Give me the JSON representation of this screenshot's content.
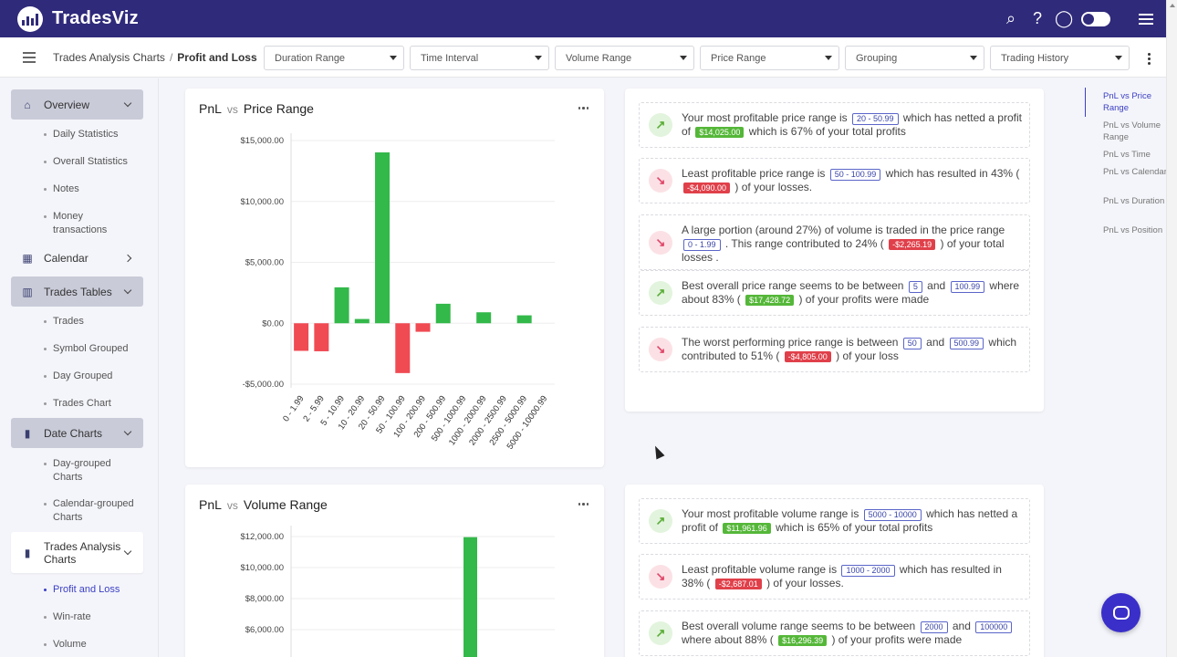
{
  "app": {
    "name": "TradesViz"
  },
  "topbar": {
    "icons": [
      "search-icon",
      "help-icon",
      "chat-icon",
      "theme-toggle",
      "menu-icon"
    ]
  },
  "breadcrumb": {
    "parent": "Trades Analysis Charts",
    "separator": "/",
    "current": "Profit and Loss"
  },
  "filters": [
    "Duration Range",
    "Time Interval",
    "Volume Range",
    "Price Range",
    "Grouping",
    "Trading History"
  ],
  "sidebar": {
    "overview": "Overview",
    "overview_items": [
      "Daily Statistics",
      "Overall Statistics",
      "Notes",
      "Money transactions"
    ],
    "calendar": "Calendar",
    "trades_tables": "Trades Tables",
    "trades_items": [
      "Trades",
      "Symbol Grouped",
      "Day Grouped",
      "Trades Chart"
    ],
    "date_charts": "Date Charts",
    "date_items": [
      "Day-grouped Charts",
      "Calendar-grouped Charts"
    ],
    "analysis": "Trades Analysis Charts",
    "analysis_items": [
      "Profit and Loss",
      "Win-rate",
      "Volume"
    ]
  },
  "chart1": {
    "title_a": "PnL",
    "vs": "vs",
    "title_b": "Price Range",
    "chart_data": {
      "type": "bar",
      "categories": [
        "0 - 1.99",
        "2 - 5.99",
        "5 - 10.99",
        "10 - 20.99",
        "20 - 50.99",
        "50 - 100.99",
        "100 - 200.99",
        "200 - 500.99",
        "500 - 1000.99",
        "1000 - 2000.99",
        "2000 - 2500.99",
        "2500 - 5000.99",
        "5000 - 10000.99"
      ],
      "values": [
        -2265.19,
        -2300,
        2950,
        350,
        14025,
        -4090,
        -700,
        1600,
        0,
        900,
        0,
        650,
        0
      ],
      "y_ticks": [
        "-$5,000.00",
        "$0.00",
        "$5,000.00",
        "$10,000.00",
        "$15,000.00"
      ],
      "y_tick_values": [
        -5000,
        0,
        5000,
        10000,
        15000
      ],
      "ylim": [
        -5000,
        15000
      ],
      "colors": {
        "positive": "#33b84a",
        "negative": "#f04a53"
      }
    }
  },
  "chart2": {
    "title_a": "PnL",
    "vs": "vs",
    "title_b": "Volume Range",
    "chart_data": {
      "type": "bar",
      "y_ticks": [
        "$6,000.00",
        "$8,000.00",
        "$10,000.00",
        "$12,000.00"
      ],
      "y_tick_values": [
        6000,
        8000,
        10000,
        12000
      ],
      "values": [
        11961.96
      ],
      "colors": {
        "positive": "#33b84a"
      }
    }
  },
  "insights1": [
    {
      "t1": "Your most profitable price range is",
      "tag": "20 - 50.99",
      "t2": "which has netted a profit of",
      "amt": "$14,025.00",
      "t3": "which is 67% of your total profits"
    },
    {
      "t1": "Least profitable price range is",
      "tag": "50 - 100.99",
      "t2": "which has resulted in 43% (",
      "amt": "-$4,090.00",
      "t3": ") of your losses."
    },
    {
      "t1": "A large portion (around 27%) of volume is traded in the price range",
      "tag": "0 - 1.99",
      "t2": ". This range contributed to 24% (",
      "amt": "-$2,265.19",
      "t3": ") of your total losses ."
    },
    {
      "t1": "Best overall price range seems to be between",
      "tag": "5",
      "t2": "and",
      "tag2": "100.99",
      "t3": "where about 83% (",
      "amt": "$17,428.72",
      "t4": ") of your profits were made"
    },
    {
      "t1": "The worst performing price range is between",
      "tag": "50",
      "t2": "and",
      "tag2": "500.99",
      "t3": "which contributed to 51% (",
      "amt": "-$4,805.00",
      "t4": ") of your loss"
    }
  ],
  "insights2": [
    {
      "t1": "Your most profitable volume range is",
      "tag": "5000 - 10000",
      "t2": "which has netted a profit of",
      "amt": "$11,961.96",
      "t3": "which is 65% of your total profits"
    },
    {
      "t1": "Least profitable volume range is",
      "tag": "1000 - 2000",
      "t2": "which has resulted in 38% (",
      "amt": "-$2,687.01",
      "t3": ") of your losses."
    },
    {
      "t1": "Best overall volume range seems to be between",
      "tag": "2000",
      "t2": "and",
      "tag2": "100000",
      "t3": "where about 88% (",
      "amt": "$16,296.39",
      "t4": ") of your profits were made"
    }
  ],
  "rightnav": [
    "PnL vs Price Range",
    "PnL vs Volume Range",
    "PnL vs Time",
    "PnL vs Calendar",
    "PnL vs Duration",
    "PnL vs Position"
  ]
}
